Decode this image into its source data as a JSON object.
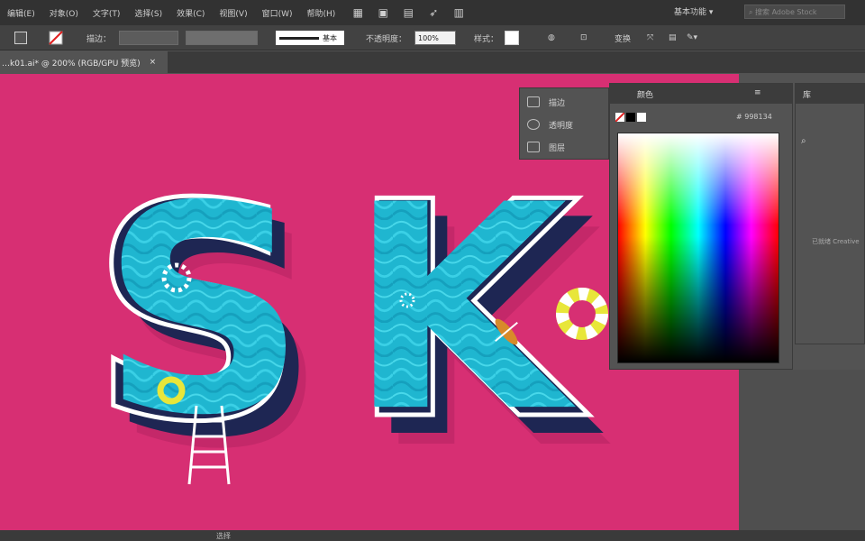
{
  "menu": {
    "items": [
      "编辑(E)",
      "对象(O)",
      "文字(T)",
      "选择(S)",
      "效果(C)",
      "视图(V)",
      "窗口(W)",
      "帮助(H)"
    ]
  },
  "top_right": {
    "workspace": "基本功能",
    "workspace_arrow": "▾",
    "search_placeholder": "搜索 Adobe Stock"
  },
  "control": {
    "stroke_label": "描边：",
    "stroke_style": "基本",
    "opacity_label": "不透明度：",
    "opacity_value": "100%",
    "style_label": "样式：",
    "transform_label": "变换"
  },
  "document_tab": {
    "title": "…k01.ai* @ 200% (RGB/GPU 预览)",
    "close": "×"
  },
  "mini_panel": {
    "items": [
      "描边",
      "透明度",
      "图层"
    ]
  },
  "color_panel": {
    "tab": "颜色",
    "hex_prefix": "#",
    "hex_value": "998134"
  },
  "library_panel": {
    "tab": "库",
    "note": "已就绪 Creative"
  },
  "status": {
    "text": "选择"
  },
  "colors": {
    "artboard": "#d72f73",
    "letter_dark": "#1e2653",
    "letter_fill": "#1fb6d0",
    "outline": "#ffffff",
    "float_yellow": "#e8e63a"
  }
}
